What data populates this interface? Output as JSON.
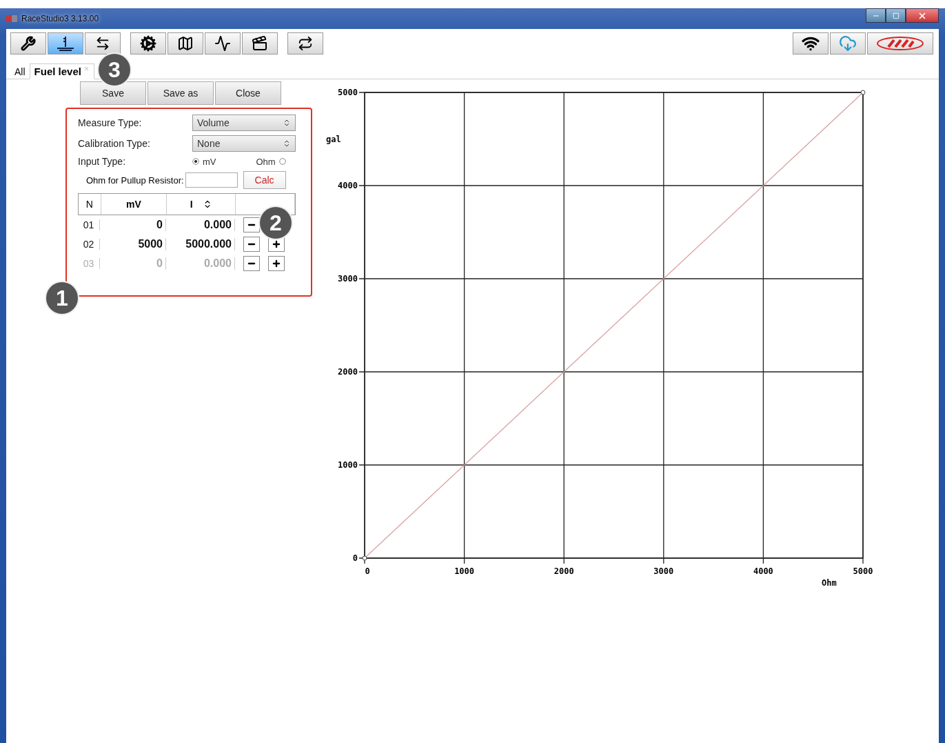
{
  "window": {
    "title": "RaceStudio3 3.13.00"
  },
  "toolbar": {
    "left": [
      {
        "kind": "tools",
        "selected": false
      },
      {
        "kind": "level",
        "selected": true
      },
      {
        "kind": "arrows",
        "selected": false
      },
      {
        "kind": "gear",
        "selected": false
      },
      {
        "kind": "track",
        "selected": false
      },
      {
        "kind": "graph",
        "selected": false
      },
      {
        "kind": "clapper",
        "selected": false
      },
      {
        "kind": "transfer",
        "selected": false
      }
    ],
    "right": [
      {
        "kind": "wifi",
        "selected": false
      },
      {
        "kind": "cloud",
        "selected": false
      },
      {
        "kind": "logo",
        "selected": false
      }
    ]
  },
  "tabs": [
    {
      "label": "All",
      "selected": false,
      "closable": false
    },
    {
      "label": "Fuel level",
      "selected": true,
      "closable": true
    }
  ],
  "actions": [
    "Save",
    "Save as",
    "Close"
  ],
  "form": {
    "measure_type": {
      "label": "Measure Type:",
      "value": "Volume"
    },
    "calibration_type": {
      "label": "Calibration Type:",
      "value": "None"
    },
    "input_type": {
      "label": "Input Type:",
      "options": [
        {
          "label": "mV",
          "selected": true
        },
        {
          "label": "Ohm",
          "selected": false
        }
      ]
    },
    "pullup": {
      "label": "Ohm for Pullup Resistor:",
      "button": "Calc"
    }
  },
  "table": {
    "columns": [
      "N",
      "mV",
      "I"
    ],
    "rows": [
      {
        "cells": [
          "01",
          "0",
          "0.000"
        ],
        "disabled": false
      },
      {
        "cells": [
          "02",
          "5000",
          "5000.000"
        ],
        "disabled": false
      },
      {
        "cells": [
          "03",
          "0",
          "0.000"
        ],
        "disabled": true
      }
    ]
  },
  "chart_data": {
    "type": "line",
    "xlabel": "Ohm",
    "ylabel": "gal",
    "x": [
      0,
      5000
    ],
    "grid": true,
    "series": [
      {
        "color": "#d8a0a0",
        "marker": "circle",
        "values": [
          0,
          5000
        ]
      }
    ],
    "xlim": [
      0,
      5000
    ],
    "ylim": [
      0,
      5000
    ],
    "xticks": [
      0,
      1000,
      2000,
      3000,
      4000,
      5000
    ],
    "yticks": [
      0,
      1000,
      2000,
      3000,
      4000,
      5000
    ]
  },
  "callouts": [
    "1",
    "2",
    "3"
  ]
}
